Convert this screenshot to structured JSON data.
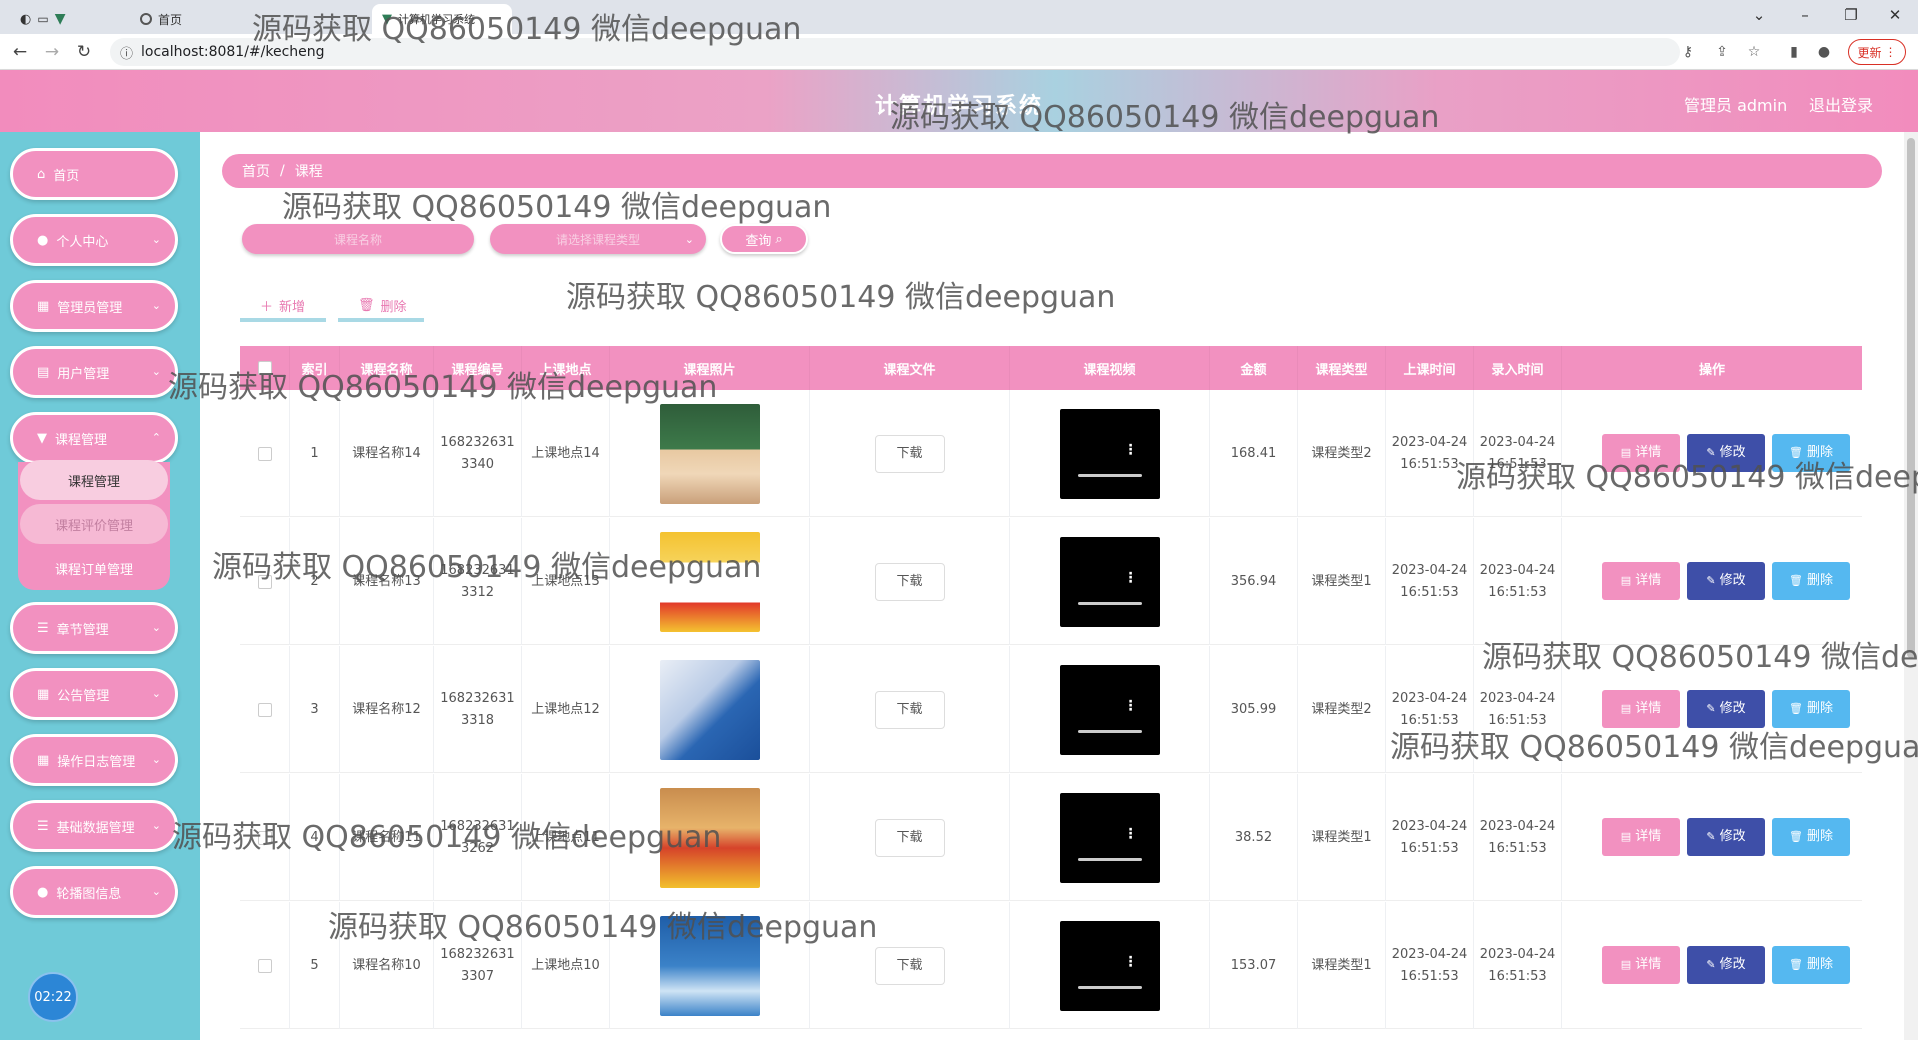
{
  "browser": {
    "tabs": [
      {
        "title": "首页"
      },
      {
        "title": "计算机学习系统"
      }
    ],
    "url": "localhost:8081/#/kecheng",
    "update_label": "更新"
  },
  "header": {
    "title": "计算机学习系统",
    "user_label": "管理员 admin",
    "logout_label": "退出登录"
  },
  "sidebar": {
    "items": [
      {
        "label": "首页",
        "icon": "home-icon"
      },
      {
        "label": "个人中心",
        "icon": "user-icon"
      },
      {
        "label": "管理员管理",
        "icon": "grid-icon"
      },
      {
        "label": "用户管理",
        "icon": "clipboard-icon"
      },
      {
        "label": "课程管理",
        "icon": "cup-icon"
      },
      {
        "label": "章节管理",
        "icon": "list-icon"
      },
      {
        "label": "公告管理",
        "icon": "grid-icon"
      },
      {
        "label": "操作日志管理",
        "icon": "grid-icon"
      },
      {
        "label": "基础数据管理",
        "icon": "list-icon"
      },
      {
        "label": "轮播图信息",
        "icon": "bulb-icon"
      }
    ],
    "submenu": [
      {
        "label": "课程管理"
      },
      {
        "label": "课程评价管理"
      },
      {
        "label": "课程订单管理"
      }
    ],
    "timer": "02:22"
  },
  "breadcrumb": {
    "home": "首页",
    "separator": "/",
    "current": "课程"
  },
  "search": {
    "name_placeholder": "课程名称",
    "type_placeholder": "请选择课程类型",
    "button_label": "查询"
  },
  "actions": {
    "add_label": "新增",
    "delete_label": "删除"
  },
  "table": {
    "headers": [
      "索引",
      "课程名称",
      "课程编号",
      "上课地点",
      "课程照片",
      "课程文件",
      "课程视频",
      "金额",
      "课程类型",
      "上课时间",
      "录入时间",
      "操作"
    ],
    "download_label": "下载",
    "detail_label": "详情",
    "edit_label": "修改",
    "remove_label": "删除",
    "rows": [
      {
        "index": "1",
        "name": "课程名称14",
        "code": "1682326313340",
        "place": "上课地点14",
        "amount": "168.41",
        "type": "课程类型2",
        "class_time": "2023-04-24 16:51:53",
        "entry_time": "2023-04-24 16:51:53"
      },
      {
        "index": "2",
        "name": "课程名称13",
        "code": "1682326313312",
        "place": "上课地点13",
        "amount": "356.94",
        "type": "课程类型1",
        "class_time": "2023-04-24 16:51:53",
        "entry_time": "2023-04-24 16:51:53"
      },
      {
        "index": "3",
        "name": "课程名称12",
        "code": "1682326313318",
        "place": "上课地点12",
        "amount": "305.99",
        "type": "课程类型2",
        "class_time": "2023-04-24 16:51:53",
        "entry_time": "2023-04-24 16:51:53"
      },
      {
        "index": "4",
        "name": "课程名称11",
        "code": "1682326313262",
        "place": "上课地点11",
        "amount": "38.52",
        "type": "课程类型1",
        "class_time": "2023-04-24 16:51:53",
        "entry_time": "2023-04-24 16:51:53"
      },
      {
        "index": "5",
        "name": "课程名称10",
        "code": "1682326313307",
        "place": "上课地点10",
        "amount": "153.07",
        "type": "课程类型1",
        "class_time": "2023-04-24 16:51:53",
        "entry_time": "2023-04-24 16:51:53"
      }
    ]
  },
  "watermark": "源码获取 QQ86050149 微信deepguan",
  "colors": {
    "pink": "#f291c0",
    "teal": "#6fcad8",
    "edit_blue": "#3e4fa8",
    "delete_blue": "#55b8f0"
  }
}
